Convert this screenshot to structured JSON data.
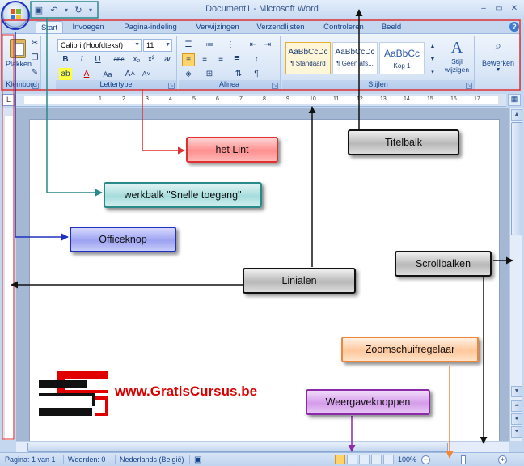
{
  "window": {
    "title": "Document1 - Microsoft Word",
    "controls": [
      "minimize-icon",
      "maximize-icon",
      "close-icon"
    ]
  },
  "qat": {
    "icons": [
      "save-icon",
      "undo-icon",
      "redo-icon",
      "customize-qat-icon"
    ]
  },
  "ribbon": {
    "tabs": [
      {
        "label": "Start",
        "active": true
      },
      {
        "label": "Invoegen"
      },
      {
        "label": "Pagina-indeling"
      },
      {
        "label": "Verwijzingen"
      },
      {
        "label": "Verzendlijsten"
      },
      {
        "label": "Controleren"
      },
      {
        "label": "Beeld"
      }
    ],
    "groups": {
      "klembord": {
        "label": "Klembord",
        "paste_label": "Plakken"
      },
      "lettertype": {
        "label": "Lettertype",
        "font": "Calibri (Hoofdtekst)",
        "size": "11"
      },
      "alinea": {
        "label": "Alinea"
      },
      "stijlen": {
        "label": "Stijlen",
        "styles": [
          {
            "sample": "AaBbCcDc",
            "name": "¶ Standaard",
            "selected": true
          },
          {
            "sample": "AaBbCcDc",
            "name": "¶ Geen afs..."
          },
          {
            "sample": "AaBbCc",
            "name": "Kop 1"
          }
        ],
        "change_styles_label": "Stijl wijzigen"
      },
      "bewerken": {
        "label": "Bewerken"
      }
    }
  },
  "statusbar": {
    "page": "Pagina: 1 van 1",
    "words": "Woorden: 0",
    "language": "Nederlands (België)",
    "zoom": "100%"
  },
  "callouts": {
    "lint": "het Lint",
    "titelbalk": "Titelbalk",
    "qat": "werkbalk \"Snelle toegang\"",
    "officeknop": "Officeknop",
    "linialen": "Linialen",
    "scrollbalken": "Scrollbalken",
    "zoom": "Zoomschuifregelaar",
    "weergave": "Weergaveknoppen"
  },
  "logo": {
    "text": "www.GratisCursus.be"
  },
  "colors": {
    "red": "#e03030",
    "teal": "#2a8a8a",
    "blue": "#2030c0",
    "black": "#111111",
    "orange": "#f0863a",
    "purple": "#8a2aa8",
    "ribbon_bg": "#dce8f7"
  }
}
